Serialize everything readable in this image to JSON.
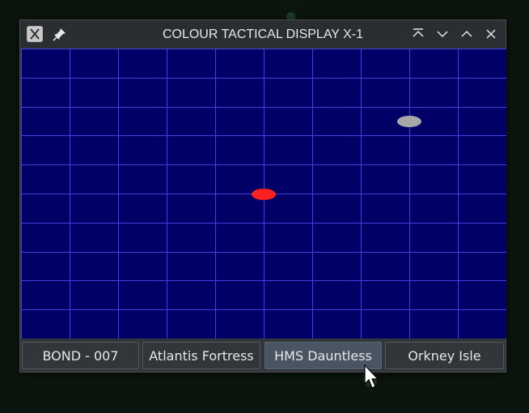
{
  "window": {
    "title": "COLOUR TACTICAL DISPLAY X-1",
    "icons": {
      "app": "x-logo-icon",
      "pin": "pin-icon",
      "keep_above": "keep-above-icon",
      "minimize": "chevron-down-icon",
      "maximize": "chevron-up-icon",
      "close": "close-icon"
    }
  },
  "display": {
    "background_color": "#000066",
    "grid_color": "#4040e0",
    "grid_columns": 10,
    "grid_rows": 10,
    "contacts": [
      {
        "label": "",
        "color": "#ff2020"
      },
      {
        "label": "",
        "color": "#a8a8a8"
      }
    ]
  },
  "buttons": [
    {
      "label": "BOND - 007"
    },
    {
      "label": "Atlantis Fortress"
    },
    {
      "label": "HMS Dauntless"
    },
    {
      "label": "Orkney Isle"
    }
  ]
}
